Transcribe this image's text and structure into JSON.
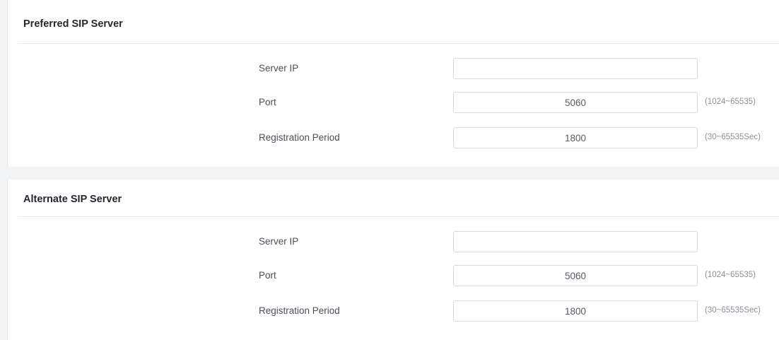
{
  "sections": [
    {
      "title": "Preferred SIP Server",
      "server_ip": {
        "label": "Server IP",
        "value": ""
      },
      "port": {
        "label": "Port",
        "value": "5060",
        "hint": "(1024~65535)"
      },
      "registration_period": {
        "label": "Registration Period",
        "value": "1800",
        "hint": "(30~65535Sec)"
      }
    },
    {
      "title": "Alternate SIP Server",
      "server_ip": {
        "label": "Server IP",
        "value": ""
      },
      "port": {
        "label": "Port",
        "value": "5060",
        "hint": "(1024~65535)"
      },
      "registration_period": {
        "label": "Registration Period",
        "value": "1800",
        "hint": "(30~65535Sec)"
      }
    }
  ],
  "colors": {
    "page_background": "#f2f3f5",
    "card_background": "#ffffff",
    "title_text": "#23272e",
    "label_text": "#4a4f57",
    "hint_text": "#8b9099",
    "field_border": "#d7dade"
  }
}
